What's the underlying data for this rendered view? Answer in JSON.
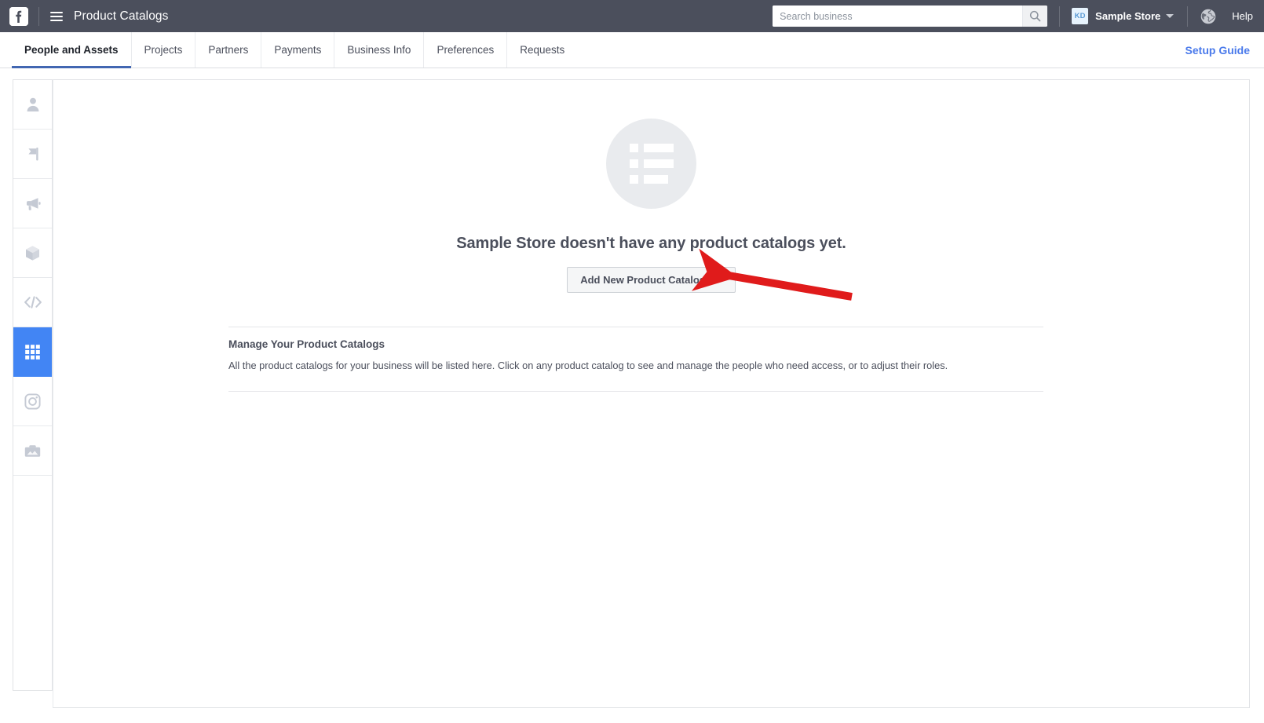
{
  "topbar": {
    "logo_icon": "facebook-logo-icon",
    "menu_icon": "hamburger-menu-icon",
    "title": "Product Catalogs",
    "search": {
      "placeholder": "Search business",
      "value": "",
      "button_icon": "search-icon"
    },
    "account": {
      "initials": "KD",
      "name": "Sample Store",
      "caret_icon": "chevron-down-icon"
    },
    "globe_icon": "globe-icon",
    "help_label": "Help",
    "background_color": "#4b4f5c"
  },
  "tabbar": {
    "tabs": [
      {
        "label": "People and Assets",
        "active": true
      },
      {
        "label": "Projects",
        "active": false
      },
      {
        "label": "Partners",
        "active": false
      },
      {
        "label": "Payments",
        "active": false
      },
      {
        "label": "Business Info",
        "active": false
      },
      {
        "label": "Preferences",
        "active": false
      },
      {
        "label": "Requests",
        "active": false
      }
    ],
    "setup_guide_label": "Setup Guide",
    "setup_guide_color": "#4a7aeb",
    "active_underline_color": "#4267b2"
  },
  "rail": {
    "items": [
      {
        "icon": "person-icon",
        "active": false
      },
      {
        "icon": "flag-icon",
        "active": false
      },
      {
        "icon": "megaphone-icon",
        "active": false
      },
      {
        "icon": "box-icon",
        "active": false
      },
      {
        "icon": "code-icon",
        "active": false
      },
      {
        "icon": "grid-apps-icon",
        "active": true
      },
      {
        "icon": "instagram-icon",
        "active": false
      },
      {
        "icon": "briefcase-image-icon",
        "active": false
      }
    ],
    "active_color": "#4285f4",
    "inactive_color": "#c5cad4"
  },
  "main": {
    "empty_state": {
      "illustration_icon": "product-list-icon",
      "title": "Sample Store doesn't have any product catalogs yet.",
      "button_label": "Add New Product Catalog",
      "button_caret_icon": "chevron-down-icon"
    },
    "manage_section": {
      "title": "Manage Your Product Catalogs",
      "description": "All the product catalogs for your business will be listed here. Click on any product catalog to see and manage the people who need access, or to adjust their roles."
    }
  },
  "annotation": {
    "arrow_icon": "red-arrow-pointing-left",
    "color": "#e01b1b"
  }
}
